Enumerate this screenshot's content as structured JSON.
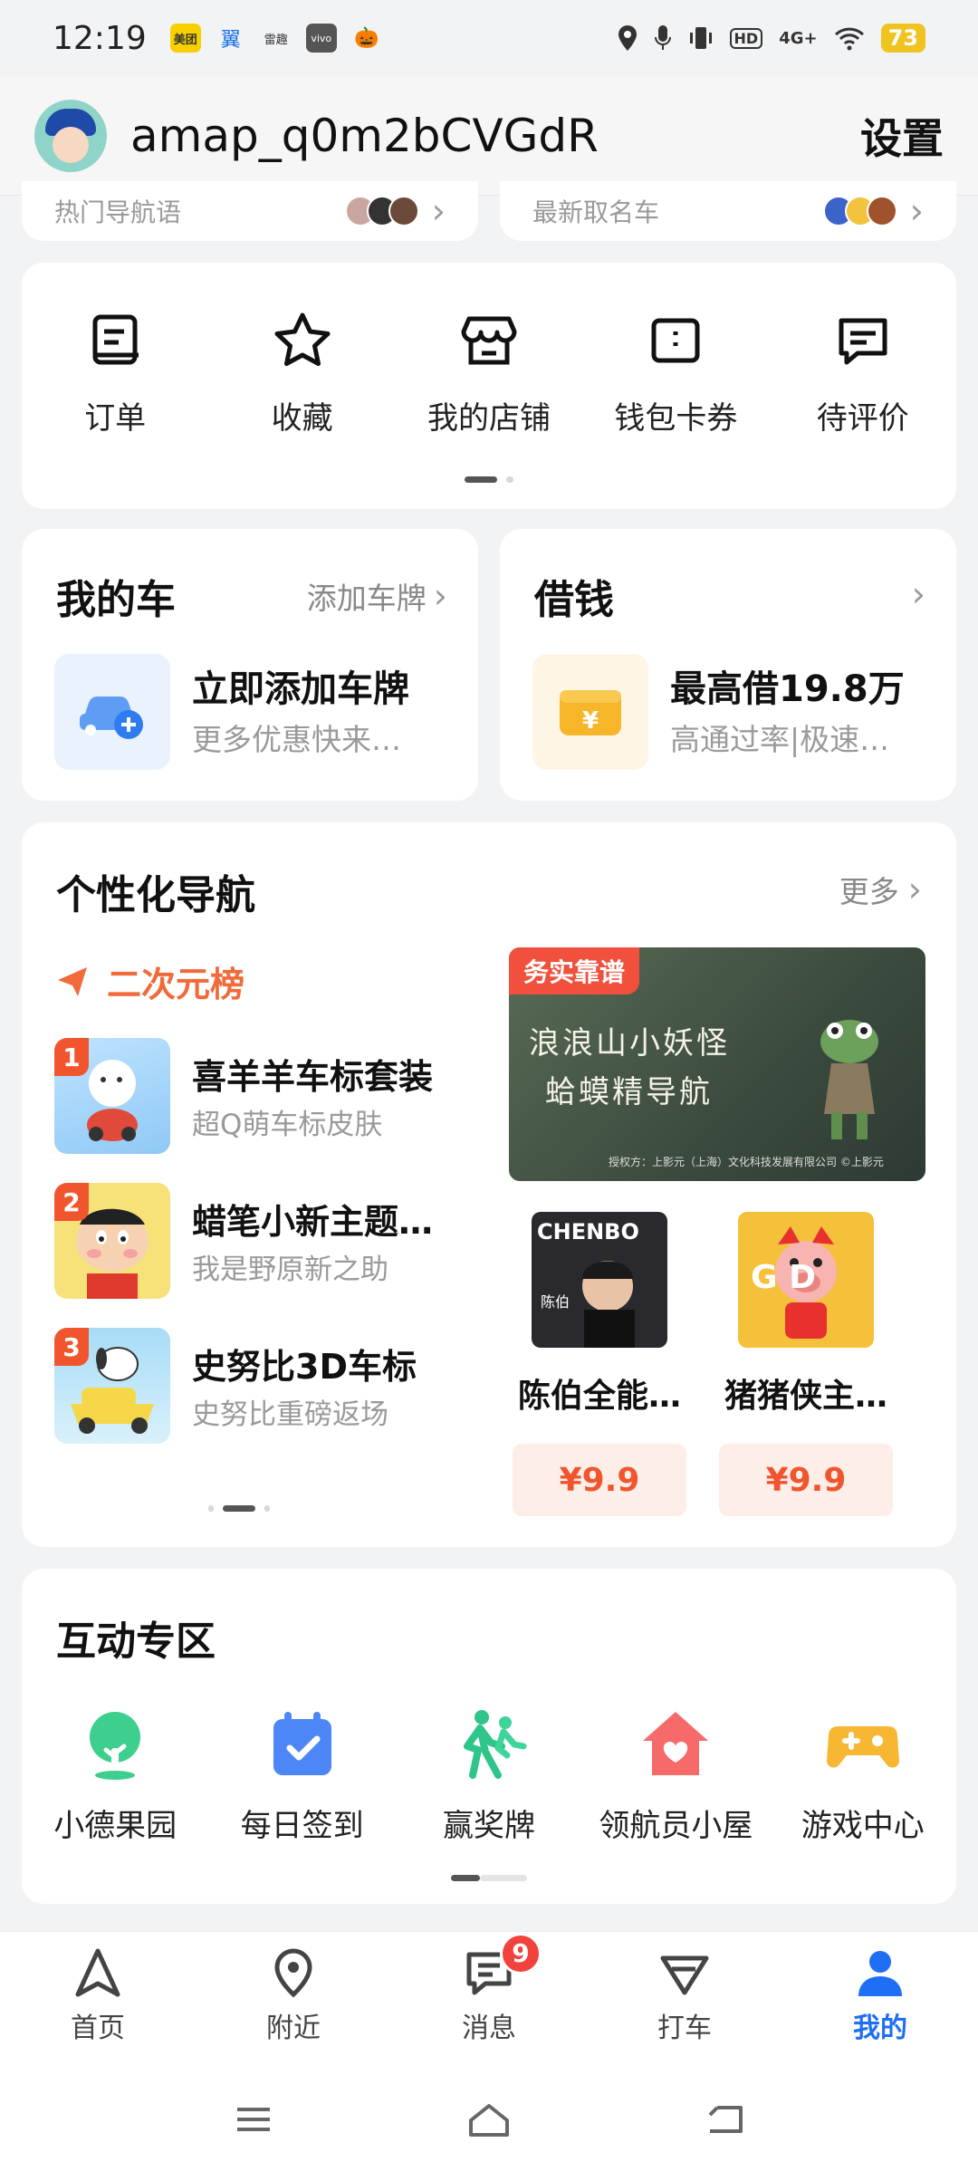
{
  "status_bar": {
    "time": "12:19",
    "apps": [
      "美团",
      "翼",
      "雷趣",
      "vivo",
      "🎃"
    ],
    "network": "4G+",
    "battery": "73"
  },
  "header": {
    "username": "amap_q0m2bCVGdR",
    "settings_label": "设置"
  },
  "top_stub": {
    "left_text": "热门导航语",
    "right_text": "最新取名车"
  },
  "quick_actions": [
    {
      "label": "订单",
      "icon": "receipt-icon"
    },
    {
      "label": "收藏",
      "icon": "star-icon"
    },
    {
      "label": "我的店铺",
      "icon": "store-icon"
    },
    {
      "label": "钱包卡券",
      "icon": "wallet-icon"
    },
    {
      "label": "待评价",
      "icon": "review-icon"
    }
  ],
  "my_car": {
    "title": "我的车",
    "link": "添加车牌",
    "main": "立即添加车牌",
    "sub": "更多优惠快来…"
  },
  "loan": {
    "title": "借钱",
    "main": "最高借19.8万",
    "sub": "高通过率|极速…"
  },
  "personal_nav": {
    "title": "个性化导航",
    "more": "更多",
    "rank_title": "二次元榜",
    "rank_items": [
      {
        "rank": "1",
        "name": "喜羊羊车标套装",
        "desc": "超Q萌车标皮肤"
      },
      {
        "rank": "2",
        "name": "蜡笔小新主题…",
        "desc": "我是野原新之助"
      },
      {
        "rank": "3",
        "name": "史努比3D车标",
        "desc": "史努比重磅返场"
      }
    ],
    "banner": {
      "tag": "务实靠谱",
      "line1": "浪浪山小妖怪",
      "line2": "蛤蟆精导航",
      "credit": "授权方：上影元（上海）文化科技发展有限公司 ©上影元"
    },
    "products": [
      {
        "name": "陈伯全能…",
        "price": "¥9.9",
        "thumb_text": "CHENBO",
        "thumb_sub": "陈伯"
      },
      {
        "name": "猪猪侠主…",
        "price": "¥9.9",
        "thumb_text": "G D"
      }
    ]
  },
  "interaction_zone": {
    "title": "互动专区",
    "items": [
      {
        "label": "小德果园",
        "icon": "tree-icon",
        "color": "#3ccf8e"
      },
      {
        "label": "每日签到",
        "icon": "calendar-check-icon",
        "color": "#4c86f7"
      },
      {
        "label": "赢奖牌",
        "icon": "running-icon",
        "color": "#2fc48a"
      },
      {
        "label": "领航员小屋",
        "icon": "house-heart-icon",
        "color": "#f66a6a"
      },
      {
        "label": "游戏中心",
        "icon": "gamepad-icon",
        "color": "#f7b733"
      }
    ]
  },
  "tab_bar": {
    "items": [
      {
        "label": "首页",
        "icon": "navigation-arrow-icon"
      },
      {
        "label": "附近",
        "icon": "location-pin-icon"
      },
      {
        "label": "消息",
        "icon": "message-icon",
        "badge": "9"
      },
      {
        "label": "打车",
        "icon": "taxi-icon"
      },
      {
        "label": "我的",
        "icon": "person-icon"
      }
    ],
    "active_index": 4
  },
  "colors": {
    "accent": "#1e6ff5",
    "rank_orange": "#f06a3a",
    "price_red": "#f0552e",
    "badge_red": "#f2423c"
  }
}
